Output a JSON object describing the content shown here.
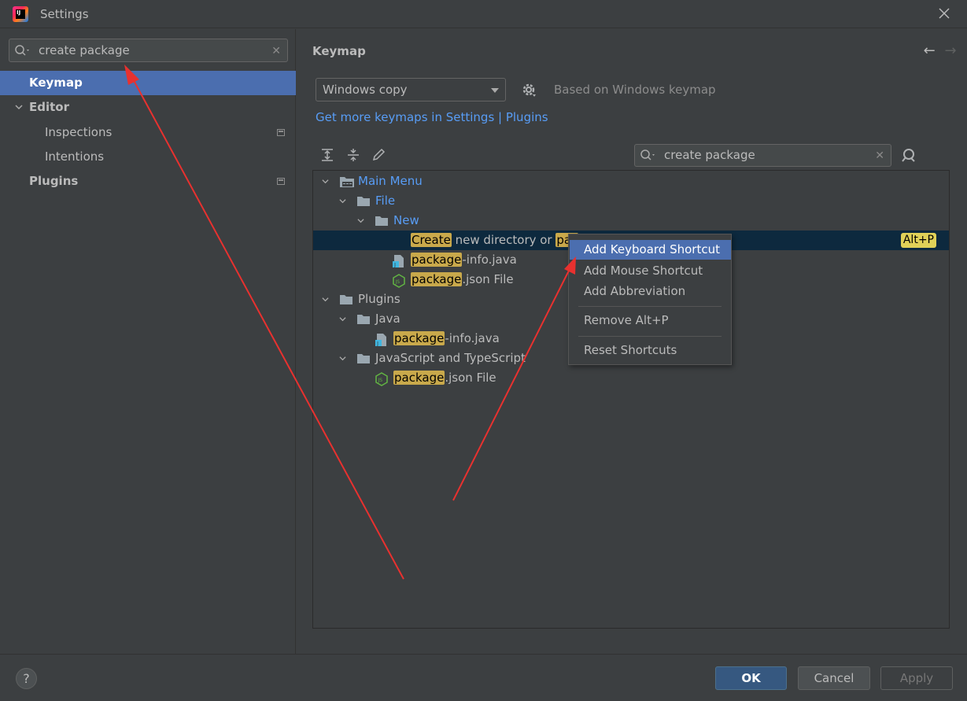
{
  "window": {
    "title": "Settings"
  },
  "sidebar": {
    "search": {
      "value": "create package"
    },
    "items": [
      {
        "label": "Keymap"
      },
      {
        "label": "Editor"
      },
      {
        "label": "Inspections"
      },
      {
        "label": "Intentions"
      },
      {
        "label": "Plugins"
      }
    ]
  },
  "main": {
    "section_title": "Keymap",
    "keymap_select": "Windows copy",
    "based_on": "Based on Windows keymap",
    "get_more_link": "Get more keymaps in Settings | Plugins",
    "tree_search": {
      "value": "create package"
    }
  },
  "tree": {
    "main_menu": "Main Menu",
    "file": "File",
    "new": "New",
    "create_hl": "Create",
    "create_rest": " new directory or ",
    "create_pkg_hl": "pac",
    "create_shortcut": "Alt+P",
    "pkg_info_hl": "package",
    "pkg_info_rest": "-info.java",
    "pkg_json_hl": "package",
    "pkg_json_rest": ".json File",
    "plugins": "Plugins",
    "java": "Java",
    "java_pkg_hl": "package",
    "java_pkg_rest": "-info.java",
    "jsts": "JavaScript and TypeScript",
    "jsts_pkg_hl": "package",
    "jsts_pkg_rest": ".json File"
  },
  "context_menu": {
    "items": [
      "Add Keyboard Shortcut",
      "Add Mouse Shortcut",
      "Add Abbreviation",
      "Remove Alt+P",
      "Reset Shortcuts"
    ]
  },
  "footer": {
    "help": "?",
    "ok": "OK",
    "cancel": "Cancel",
    "apply": "Apply"
  },
  "colors": {
    "selection": "#4b6eaf",
    "link": "#589df6",
    "highlight": "#c9a94b",
    "annotation_arrow": "#e8312f"
  }
}
